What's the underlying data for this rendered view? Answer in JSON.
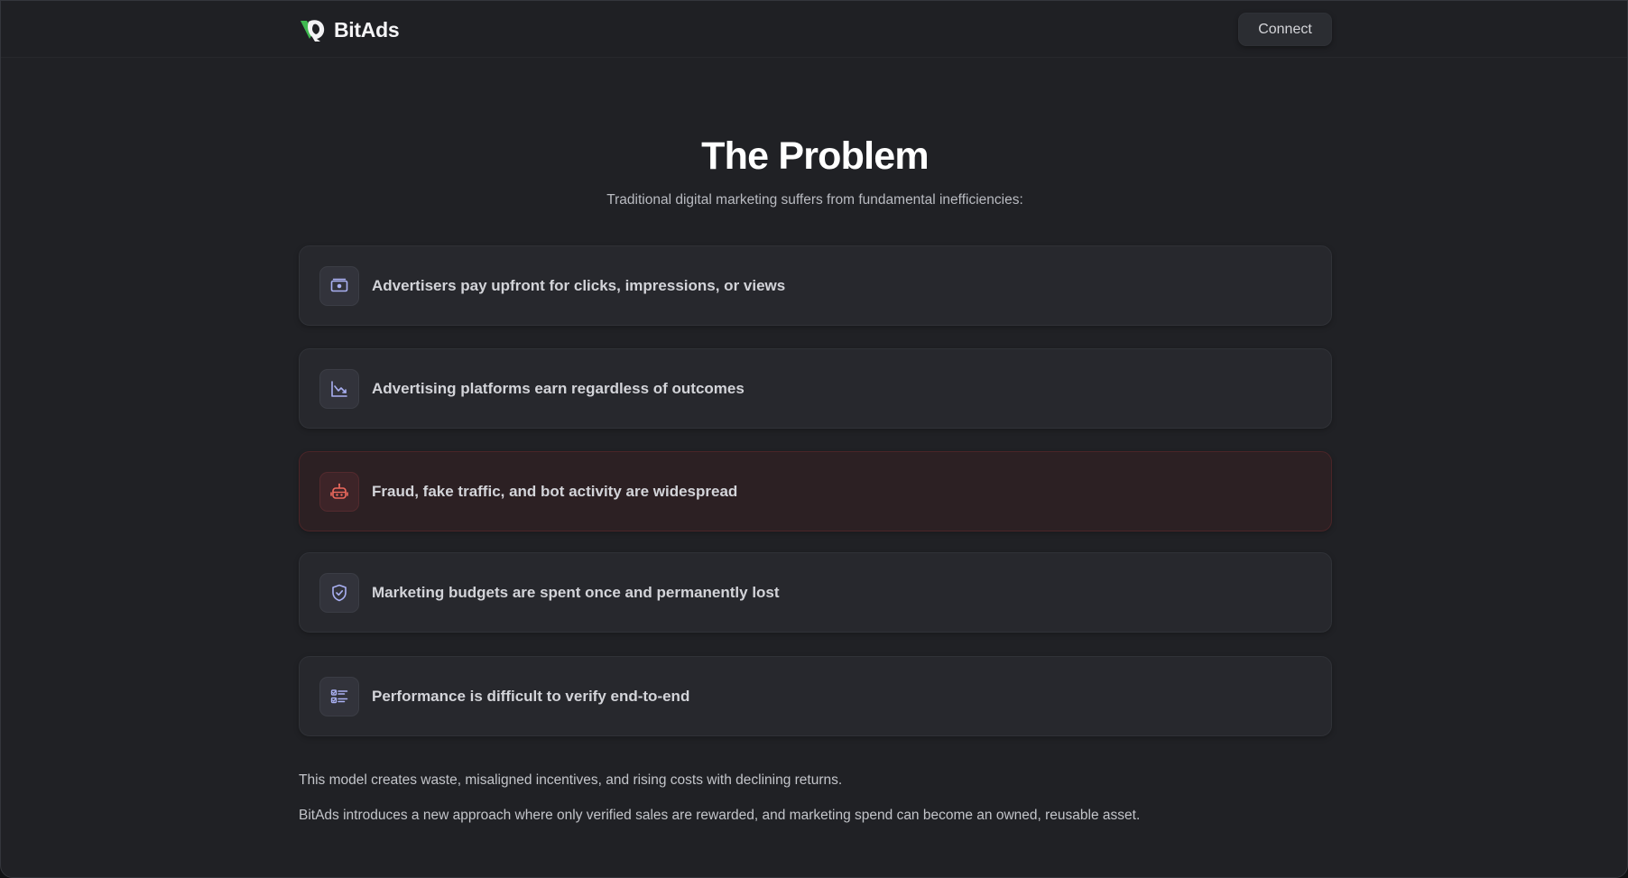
{
  "navbar": {
    "brand_name": "BitAds",
    "connect_label": "Connect",
    "logo_icon": "bitads-logo-icon",
    "logo_color": "#3fb950"
  },
  "hero": {
    "title": "The Problem",
    "subtitle": "Traditional digital marketing suffers from fundamental inefficiencies:"
  },
  "problems": [
    {
      "icon": "money-icon",
      "label": "Advertisers pay upfront for clicks, impressions, or views",
      "highlighted": false
    },
    {
      "icon": "trending-down-chart-icon",
      "label": "Advertising platforms earn regardless of outcomes",
      "highlighted": false
    },
    {
      "icon": "bot-icon",
      "label": "Fraud, fake traffic, and bot activity are widespread",
      "highlighted": true
    },
    {
      "icon": "shield-check-icon",
      "label": "Marketing budgets are spent once and permanently lost",
      "highlighted": false
    },
    {
      "icon": "checklist-icon",
      "label": "Performance is difficult to verify end-to-end",
      "highlighted": false
    }
  ],
  "footer_text": {
    "paragraph_1": "This model creates waste, misaligned incentives, and rising costs with declining returns.",
    "paragraph_2": "BitAds introduces a new approach where only verified sales are rewarded, and marketing spend can become an owned, reusable asset."
  },
  "colors": {
    "background": "#202125",
    "card": "#27282d",
    "alert_card": "#2c2023",
    "icon_default": "#a9b0f2",
    "icon_alert": "#ef6a5e"
  }
}
